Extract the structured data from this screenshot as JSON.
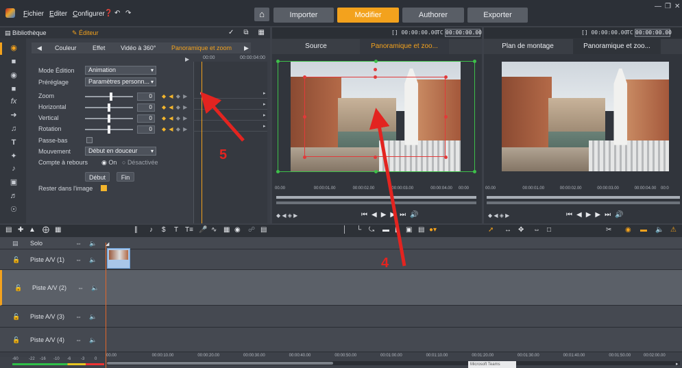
{
  "menu": {
    "file": "Fichier",
    "edit": "Editer",
    "configure": "Configurer"
  },
  "main_tabs": [
    "Importer",
    "Modifier",
    "Authorer",
    "Exporter"
  ],
  "editor": {
    "library_label": "Bibliothèque",
    "editor_label": "Éditeur",
    "subtabs": [
      "Couleur",
      "Effet",
      "Vidéo à 360°",
      "Panoramique et zoom"
    ],
    "kf_times": [
      "00:00",
      "00:00:04:00"
    ],
    "edit_mode_label": "Mode Édition",
    "edit_mode_value": "Animation",
    "preset_label": "Préréglage",
    "preset_value": "Paramètres personn...",
    "params": [
      {
        "label": "Zoom",
        "value": "0",
        "slider": 0.55
      },
      {
        "label": "Horizontal",
        "value": "0",
        "slider": 0.5
      },
      {
        "label": "Vertical",
        "value": "0",
        "slider": 0.5
      },
      {
        "label": "Rotation",
        "value": "0",
        "slider": 0.5
      }
    ],
    "lowpass_label": "Passe-bas",
    "movement_label": "Mouvement",
    "movement_value": "Début en douceur",
    "countdown_label": "Compte à rebours",
    "on_label": "On",
    "off_label": "Désactivée",
    "start_button": "Début",
    "end_button": "Fin",
    "stay_label": "Rester dans l'image"
  },
  "source_preview": {
    "timecode": "[] 00:00:00.00",
    "tc_label": "TC",
    "tc_value": "00:00:00.00",
    "tabs": [
      "Source",
      "Panoramique et zoo..."
    ],
    "ruler": [
      "00.00",
      "00:00:01.00",
      "00:00:02.00",
      "00:00:03.00",
      "00:00:04.00",
      "00:00"
    ]
  },
  "timeline_preview": {
    "timecode": "[] 00:00:00.00",
    "tc_label": "TC",
    "tc_value": "00:00:00.00",
    "tabs": [
      "Plan de montage",
      "Panoramique et zoo..."
    ],
    "ruler": [
      "00.00",
      "00:00:01.00",
      "00:00:02.00",
      "00:00:03.00",
      "00:00:04.00",
      "00:0"
    ]
  },
  "tracks": [
    {
      "name": "Solo",
      "lock": false
    },
    {
      "name": "Piste A/V (1)",
      "lock": true
    },
    {
      "name": "Piste A/V (2)",
      "lock": true
    },
    {
      "name": "Piste A/V (3)",
      "lock": true
    },
    {
      "name": "Piste A/V (4)",
      "lock": true
    }
  ],
  "timeline_ruler": [
    "00.00",
    "00:00:10.00",
    "00:00:20.00",
    "00:00:30.00",
    "00:00:40.00",
    "00:00:50.00",
    "00:01:00.00",
    "00:01:10.00",
    "00:01:20.00",
    "00:01:30.00",
    "00:01:40.00",
    "00:01:50.00",
    "00:02:00.00"
  ],
  "meter_labels": [
    "-60",
    "-22",
    "-16",
    "-10",
    "-6",
    "-3",
    "0"
  ],
  "tooltip": "Microsoft Teams",
  "annotations": {
    "five": "5",
    "four": "4"
  },
  "colors": {
    "accent": "#f3a21d",
    "annotation": "#e32420",
    "crop_frame": "#e23a3a",
    "green_frame": "#3ec04a"
  }
}
